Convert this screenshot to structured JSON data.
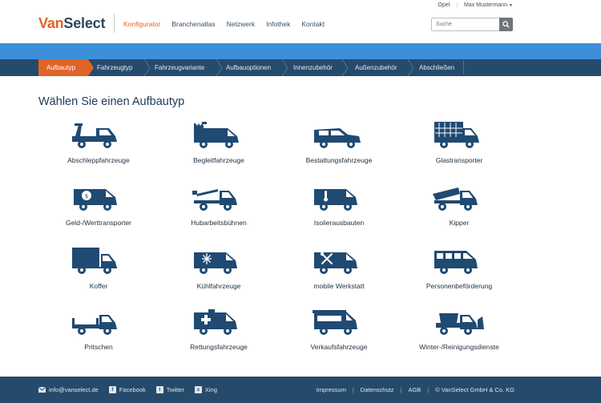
{
  "brand": {
    "part1": "Van",
    "part2": "Select"
  },
  "nav": [
    {
      "label": "Konfigurator",
      "active": true
    },
    {
      "label": "Branchenatlas",
      "active": false
    },
    {
      "label": "Netzwerk",
      "active": false
    },
    {
      "label": "Infothek",
      "active": false
    },
    {
      "label": "Kontakt",
      "active": false
    }
  ],
  "util": {
    "brand": "Opel",
    "user": "Max Mustermann"
  },
  "search": {
    "placeholder": "Suche"
  },
  "steps": [
    "Aufbautyp",
    "Fahrzeugtyp",
    "Fahrzeugvariante",
    "Aufbauoptionen",
    "Innenzubehör",
    "Außenzubehör",
    "Abschließen"
  ],
  "heading": "Wählen Sie einen Aufbautyp",
  "items": [
    {
      "label": "Abschleppfahrzeuge",
      "icon": "tow-truck-icon"
    },
    {
      "label": "Begleitfahrzeuge",
      "icon": "escort-van-icon"
    },
    {
      "label": "Bestattungsfahrzeuge",
      "icon": "hearse-icon"
    },
    {
      "label": "Glastransporter",
      "icon": "glass-transporter-icon"
    },
    {
      "label": "Geld-/Werttransporter",
      "icon": "money-transport-icon"
    },
    {
      "label": "Hubarbeitsbühnen",
      "icon": "aerial-platform-icon"
    },
    {
      "label": "Isolierausbauten",
      "icon": "insulated-van-icon"
    },
    {
      "label": "Kipper",
      "icon": "tipper-icon"
    },
    {
      "label": "Koffer",
      "icon": "box-truck-icon"
    },
    {
      "label": "Kühlfahrzeuge",
      "icon": "refrigerated-van-icon"
    },
    {
      "label": "mobile Werkstatt",
      "icon": "mobile-workshop-icon"
    },
    {
      "label": "Personenbeförderung",
      "icon": "passenger-van-icon"
    },
    {
      "label": "Pritschen",
      "icon": "flatbed-icon"
    },
    {
      "label": "Rettungsfahrzeuge",
      "icon": "ambulance-icon"
    },
    {
      "label": "Verkaufsfahrzeuge",
      "icon": "sales-van-icon"
    },
    {
      "label": "Winter-/Reinigungsdienste",
      "icon": "winter-service-icon"
    }
  ],
  "footer": {
    "email": "info@vanselect.de",
    "facebook": "Facebook",
    "twitter": "Twitter",
    "xing": "Xing",
    "impressum": "Impressum",
    "datenschutz": "Datenschutz",
    "agb": "AGB",
    "copyright": "© VanSelect GmbH & Co. KG"
  },
  "colors": {
    "accent": "#e06428",
    "navy": "#264a6b",
    "band": "#3d8fd9",
    "icon": "#1f4a72"
  }
}
